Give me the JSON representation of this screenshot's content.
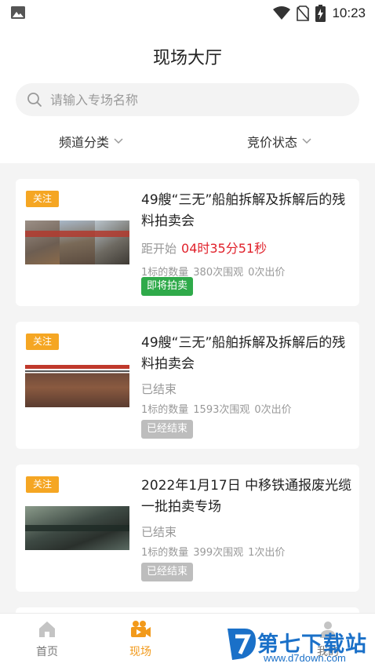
{
  "status_bar": {
    "time": "10:23"
  },
  "header": {
    "title": "现场大厅",
    "search": {
      "placeholder": "请输入专场名称",
      "value": ""
    },
    "filters": {
      "channel": "频道分类",
      "bid_status": "竞价状态"
    }
  },
  "auctions": [
    {
      "follow_label": "关注",
      "title": "49艘“三无”船舶拆解及拆解后的残料拍卖会",
      "status_prefix": "距开始",
      "countdown": "04时35分51秒",
      "lot_count": "1标的数量",
      "views": "380次围观",
      "bids": "0次出价",
      "tag": "即将拍卖",
      "tag_color": "#2faa4a"
    },
    {
      "follow_label": "关注",
      "title": "49艘“三无”船舶拆解及拆解后的残料拍卖会",
      "status_prefix": "已结束",
      "lot_count": "1标的数量",
      "views": "1593次围观",
      "bids": "0次出价",
      "tag": "已经结束",
      "tag_color": "#bdbdbd"
    },
    {
      "follow_label": "关注",
      "title": "2022年1月17日 中移铁通报废光缆一批拍卖专场",
      "status_prefix": "已结束",
      "lot_count": "1标的数量",
      "views": "399次围观",
      "bids": "1次出价",
      "tag": "已经结束",
      "tag_color": "#bdbdbd"
    }
  ],
  "tab_bar": {
    "home": "首页",
    "live": "现场",
    "mine": "我的"
  },
  "watermark": {
    "text": "第七下载站",
    "url": "www.d7down.com"
  },
  "colors": {
    "accent": "#f29a1b",
    "badge": "#f5a623",
    "countdown": "#e0202a"
  }
}
